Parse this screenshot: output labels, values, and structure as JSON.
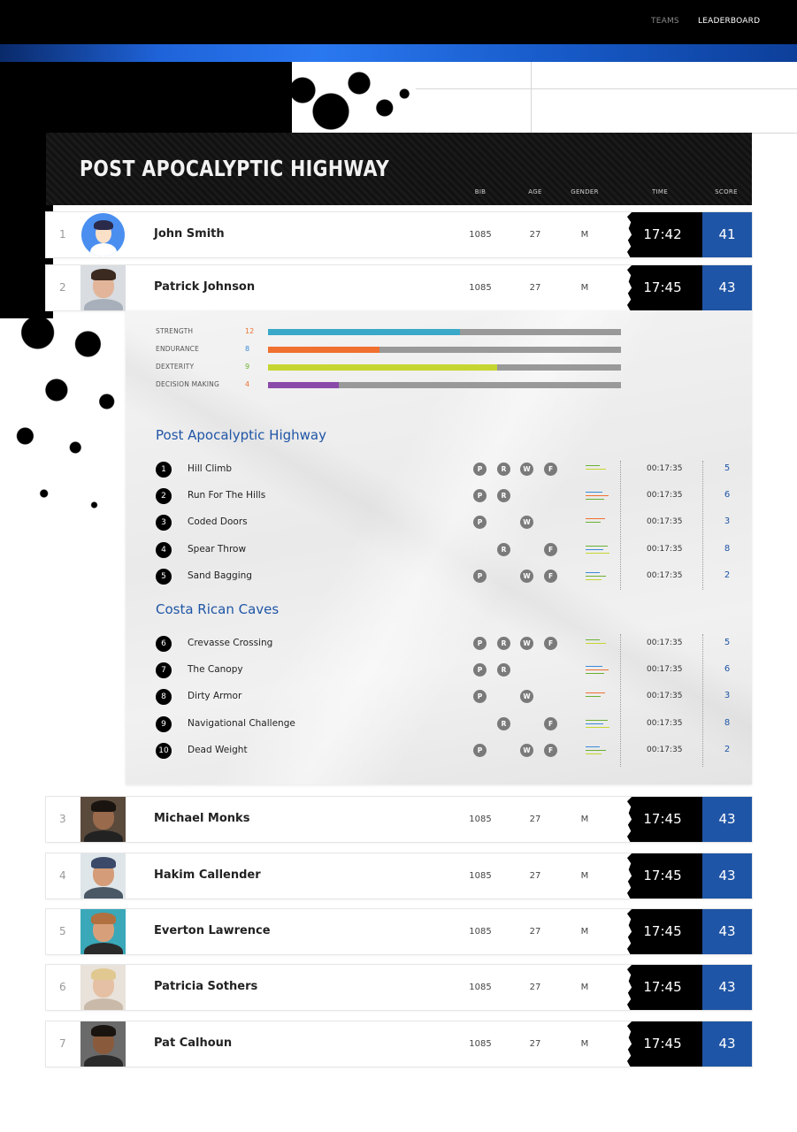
{
  "nav": {
    "teams": "TEAMS",
    "leaderboard": "LEADERBOARD"
  },
  "colors": {
    "accent": "#1f55a6",
    "time_bg": "#000000",
    "score_bg": "#1f55a6"
  },
  "board": {
    "title": "POST APOCALYPTIC HIGHWAY",
    "columns": {
      "bib": "BIB",
      "age": "AGE",
      "gender": "GENDER",
      "time": "TIME",
      "score": "SCORE"
    }
  },
  "rows": [
    {
      "rank": "1",
      "name": "John Smith",
      "bib": "1085",
      "age": "27",
      "gender": "M",
      "time": "17:42",
      "score": "41",
      "avatar": "cartoon-avatar"
    },
    {
      "rank": "2",
      "name": "Patrick Johnson",
      "bib": "1085",
      "age": "27",
      "gender": "M",
      "time": "17:45",
      "score": "43",
      "avatar": "photo-avatar"
    },
    {
      "rank": "3",
      "name": "Michael Monks",
      "bib": "1085",
      "age": "27",
      "gender": "M",
      "time": "17:45",
      "score": "43",
      "avatar": "photo-avatar"
    },
    {
      "rank": "4",
      "name": "Hakim Callender",
      "bib": "1085",
      "age": "27",
      "gender": "M",
      "time": "17:45",
      "score": "43",
      "avatar": "photo-avatar"
    },
    {
      "rank": "5",
      "name": "Everton Lawrence",
      "bib": "1085",
      "age": "27",
      "gender": "M",
      "time": "17:45",
      "score": "43",
      "avatar": "photo-avatar"
    },
    {
      "rank": "6",
      "name": "Patricia Sothers",
      "bib": "1085",
      "age": "27",
      "gender": "M",
      "time": "17:45",
      "score": "43",
      "avatar": "photo-avatar"
    },
    {
      "rank": "7",
      "name": "Pat Calhoun",
      "bib": "1085",
      "age": "27",
      "gender": "M",
      "time": "17:45",
      "score": "43",
      "avatar": "photo-avatar"
    }
  ],
  "detail": {
    "stats": [
      {
        "label": "STRENGTH",
        "value": "12",
        "fraction": 0.545,
        "color": "#3aa8c8",
        "value_color": "#f07030"
      },
      {
        "label": "ENDURANCE",
        "value": "8",
        "fraction": 0.315,
        "color": "#f07030",
        "value_color": "#3a8ad8"
      },
      {
        "label": "DEXTERITY",
        "value": "9",
        "fraction": 0.65,
        "color": "#c6d630",
        "value_color": "#6ab030"
      },
      {
        "label": "DECISION MAKING",
        "value": "4",
        "fraction": 0.2,
        "color": "#8a4aa8",
        "value_color": "#f07030"
      }
    ],
    "sections": [
      {
        "title": "Post Apocalyptic Highway",
        "challenges": [
          {
            "num": "1",
            "name": "Hill Climb",
            "badges": [
              "P",
              "R",
              "W",
              "F"
            ],
            "time": "00:17:35",
            "score": "5"
          },
          {
            "num": "2",
            "name": "Run For The Hills",
            "badges": [
              "P",
              "R",
              "",
              ""
            ],
            "time": "00:17:35",
            "score": "6"
          },
          {
            "num": "3",
            "name": "Coded Doors",
            "badges": [
              "P",
              "",
              "W",
              ""
            ],
            "time": "00:17:35",
            "score": "3"
          },
          {
            "num": "4",
            "name": "Spear Throw",
            "badges": [
              "",
              "R",
              "",
              "F"
            ],
            "time": "00:17:35",
            "score": "8"
          },
          {
            "num": "5",
            "name": "Sand Bagging",
            "badges": [
              "P",
              "",
              "W",
              "F"
            ],
            "time": "00:17:35",
            "score": "2"
          }
        ]
      },
      {
        "title": "Costa Rican Caves",
        "challenges": [
          {
            "num": "6",
            "name": "Crevasse Crossing",
            "badges": [
              "P",
              "R",
              "W",
              "F"
            ],
            "time": "00:17:35",
            "score": "5"
          },
          {
            "num": "7",
            "name": "The Canopy",
            "badges": [
              "P",
              "R",
              "",
              ""
            ],
            "time": "00:17:35",
            "score": "6"
          },
          {
            "num": "8",
            "name": "Dirty Armor",
            "badges": [
              "P",
              "",
              "W",
              ""
            ],
            "time": "00:17:35",
            "score": "3"
          },
          {
            "num": "9",
            "name": "Navigational Challenge",
            "badges": [
              "",
              "R",
              "",
              "F"
            ],
            "time": "00:17:35",
            "score": "8"
          },
          {
            "num": "10",
            "name": "Dead Weight",
            "badges": [
              "P",
              "",
              "W",
              "F"
            ],
            "time": "00:17:35",
            "score": "2"
          }
        ]
      }
    ]
  }
}
